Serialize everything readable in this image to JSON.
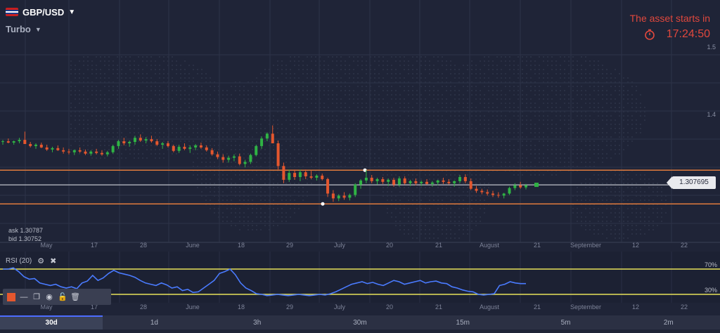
{
  "header": {
    "pair": "GBP/USD",
    "mode": "Turbo",
    "timer_title": "The asset starts in",
    "timer_value": "17:24:50"
  },
  "quotes": {
    "ask": "ask 1.30787",
    "bid": "bid 1.30752",
    "current": "1.307695"
  },
  "rsi": {
    "label": "RSI (20)",
    "upper_label": "70%",
    "lower_label": "30%"
  },
  "price_axis": {
    "labels": [
      "1.5",
      "1.4"
    ]
  },
  "x_axis": {
    "labels": [
      "May",
      "17",
      "28",
      "June",
      "18",
      "29",
      "July",
      "20",
      "21",
      "August",
      "21",
      "September",
      "12",
      "22"
    ]
  },
  "timeframes": [
    "30d",
    "1d",
    "3h",
    "30m",
    "15m",
    "5m",
    "2m"
  ],
  "selected_timeframe": "30d",
  "colors": {
    "bull": "#2fb344",
    "bear": "#e4572e",
    "level": "#e07a3c",
    "rsi_line": "#4a7bff",
    "rsi_bounds": "#e8e35a",
    "timer": "#e0483d"
  },
  "chart_data": {
    "type": "candlestick",
    "upper_level": 1.329,
    "lower_level": 1.28,
    "current_price": 1.307695,
    "candles": [
      [
        1.37,
        1.373,
        1.366,
        1.371
      ],
      [
        1.371,
        1.375,
        1.368,
        1.369
      ],
      [
        1.369,
        1.372,
        1.366,
        1.371
      ],
      [
        1.371,
        1.376,
        1.368,
        1.373
      ],
      [
        1.373,
        1.385,
        1.37,
        1.367
      ],
      [
        1.367,
        1.37,
        1.362,
        1.364
      ],
      [
        1.364,
        1.368,
        1.36,
        1.366
      ],
      [
        1.366,
        1.369,
        1.361,
        1.362
      ],
      [
        1.362,
        1.366,
        1.357,
        1.359
      ],
      [
        1.359,
        1.363,
        1.355,
        1.361
      ],
      [
        1.361,
        1.365,
        1.357,
        1.358
      ],
      [
        1.358,
        1.362,
        1.353,
        1.356
      ],
      [
        1.356,
        1.36,
        1.352,
        1.355
      ],
      [
        1.355,
        1.359,
        1.351,
        1.358
      ],
      [
        1.358,
        1.362,
        1.354,
        1.356
      ],
      [
        1.356,
        1.359,
        1.351,
        1.353
      ],
      [
        1.353,
        1.358,
        1.35,
        1.356
      ],
      [
        1.356,
        1.36,
        1.352,
        1.354
      ],
      [
        1.354,
        1.358,
        1.35,
        1.352
      ],
      [
        1.352,
        1.357,
        1.349,
        1.355
      ],
      [
        1.355,
        1.366,
        1.353,
        1.364
      ],
      [
        1.364,
        1.373,
        1.36,
        1.371
      ],
      [
        1.371,
        1.376,
        1.365,
        1.368
      ],
      [
        1.368,
        1.372,
        1.363,
        1.37
      ],
      [
        1.37,
        1.379,
        1.366,
        1.376
      ],
      [
        1.376,
        1.381,
        1.37,
        1.372
      ],
      [
        1.372,
        1.377,
        1.368,
        1.374
      ],
      [
        1.374,
        1.379,
        1.369,
        1.371
      ],
      [
        1.371,
        1.374,
        1.364,
        1.366
      ],
      [
        1.366,
        1.37,
        1.36,
        1.368
      ],
      [
        1.368,
        1.371,
        1.362,
        1.364
      ],
      [
        1.364,
        1.366,
        1.355,
        1.357
      ],
      [
        1.357,
        1.366,
        1.354,
        1.363
      ],
      [
        1.363,
        1.368,
        1.358,
        1.36
      ],
      [
        1.36,
        1.365,
        1.354,
        1.362
      ],
      [
        1.362,
        1.367,
        1.358,
        1.365
      ],
      [
        1.365,
        1.369,
        1.36,
        1.362
      ],
      [
        1.362,
        1.365,
        1.356,
        1.358
      ],
      [
        1.358,
        1.361,
        1.35,
        1.352
      ],
      [
        1.352,
        1.356,
        1.345,
        1.348
      ],
      [
        1.348,
        1.352,
        1.34,
        1.344
      ],
      [
        1.344,
        1.35,
        1.34,
        1.347
      ],
      [
        1.347,
        1.352,
        1.342,
        1.349
      ],
      [
        1.349,
        1.353,
        1.336,
        1.338
      ],
      [
        1.338,
        1.344,
        1.333,
        1.341
      ],
      [
        1.341,
        1.353,
        1.338,
        1.351
      ],
      [
        1.351,
        1.366,
        1.349,
        1.364
      ],
      [
        1.364,
        1.378,
        1.36,
        1.375
      ],
      [
        1.375,
        1.384,
        1.371,
        1.382
      ],
      [
        1.382,
        1.394,
        1.371,
        1.368
      ],
      [
        1.368,
        1.372,
        1.33,
        1.335
      ],
      [
        1.335,
        1.34,
        1.31,
        1.315
      ],
      [
        1.315,
        1.33,
        1.312,
        1.325
      ],
      [
        1.325,
        1.33,
        1.315,
        1.319
      ],
      [
        1.319,
        1.33,
        1.313,
        1.326
      ],
      [
        1.326,
        1.33,
        1.316,
        1.32
      ],
      [
        1.32,
        1.328,
        1.316,
        1.318
      ],
      [
        1.318,
        1.323,
        1.314,
        1.321
      ],
      [
        1.321,
        1.324,
        1.314,
        1.316
      ],
      [
        1.316,
        1.318,
        1.29,
        1.295
      ],
      [
        1.295,
        1.3,
        1.283,
        1.288
      ],
      [
        1.288,
        1.294,
        1.284,
        1.292
      ],
      [
        1.292,
        1.297,
        1.286,
        1.289
      ],
      [
        1.289,
        1.295,
        1.285,
        1.293
      ],
      [
        1.293,
        1.31,
        1.29,
        1.308
      ],
      [
        1.308,
        1.316,
        1.302,
        1.314
      ],
      [
        1.314,
        1.329,
        1.31,
        1.318
      ],
      [
        1.318,
        1.322,
        1.31,
        1.313
      ],
      [
        1.313,
        1.318,
        1.308,
        1.316
      ],
      [
        1.316,
        1.319,
        1.309,
        1.312
      ],
      [
        1.312,
        1.317,
        1.306,
        1.315
      ],
      [
        1.315,
        1.318,
        1.305,
        1.308
      ],
      [
        1.308,
        1.32,
        1.305,
        1.317
      ],
      [
        1.317,
        1.32,
        1.308,
        1.31
      ],
      [
        1.31,
        1.315,
        1.306,
        1.313
      ],
      [
        1.313,
        1.317,
        1.307,
        1.31
      ],
      [
        1.31,
        1.314,
        1.306,
        1.312
      ],
      [
        1.312,
        1.316,
        1.308,
        1.309
      ],
      [
        1.309,
        1.313,
        1.305,
        1.311
      ],
      [
        1.311,
        1.315,
        1.307,
        1.314
      ],
      [
        1.314,
        1.318,
        1.309,
        1.312
      ],
      [
        1.312,
        1.316,
        1.308,
        1.31
      ],
      [
        1.31,
        1.314,
        1.305,
        1.313
      ],
      [
        1.313,
        1.322,
        1.31,
        1.319
      ],
      [
        1.319,
        1.323,
        1.31,
        1.313
      ],
      [
        1.313,
        1.317,
        1.3,
        1.302
      ],
      [
        1.302,
        1.306,
        1.296,
        1.299
      ],
      [
        1.299,
        1.302,
        1.294,
        1.297
      ],
      [
        1.297,
        1.301,
        1.292,
        1.295
      ],
      [
        1.295,
        1.299,
        1.29,
        1.293
      ],
      [
        1.293,
        1.297,
        1.289,
        1.292
      ],
      [
        1.292,
        1.296,
        1.288,
        1.295
      ],
      [
        1.295,
        1.305,
        1.293,
        1.303
      ],
      [
        1.303,
        1.31,
        1.3,
        1.307
      ],
      [
        1.307,
        1.312,
        1.302,
        1.304
      ],
      [
        1.304,
        1.309,
        1.301,
        1.307
      ]
    ],
    "rsi_values": [
      70,
      70,
      72,
      66,
      58,
      54,
      55,
      48,
      46,
      44,
      46,
      42,
      40,
      42,
      39,
      48,
      51,
      60,
      52,
      56,
      63,
      68,
      64,
      62,
      60,
      57,
      52,
      48,
      46,
      44,
      48,
      45,
      40,
      42,
      36,
      38,
      33,
      34,
      40,
      46,
      52,
      63,
      66,
      70,
      61,
      48,
      40,
      36,
      31,
      30,
      28,
      29,
      30,
      29,
      28,
      29,
      30,
      29,
      28,
      29,
      30,
      29,
      31,
      34,
      38,
      42,
      46,
      48,
      50,
      47,
      49,
      46,
      44,
      48,
      52,
      50,
      46,
      48,
      50,
      52,
      48,
      50,
      51,
      48,
      47,
      42,
      40,
      37,
      35,
      34,
      30,
      29,
      30,
      31,
      44,
      46,
      50,
      48,
      47,
      47
    ],
    "rsi_upper": 70,
    "rsi_lower": 30
  }
}
